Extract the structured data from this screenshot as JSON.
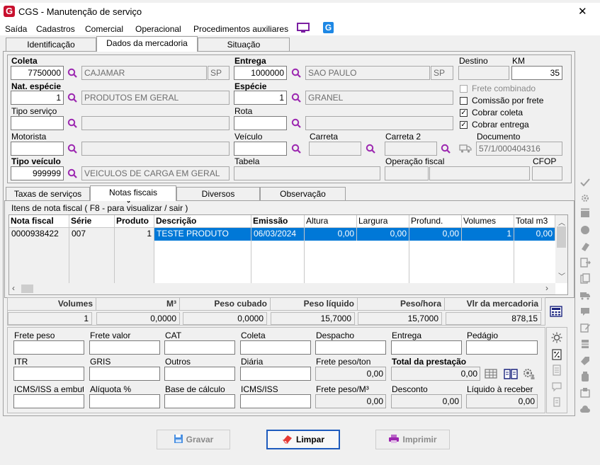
{
  "window": {
    "title": "CGS - Manutenção de serviço",
    "close": "✕"
  },
  "menu": [
    "Saída",
    "Cadastros",
    "Comercial",
    "Operacional",
    "Procedimentos auxiliares"
  ],
  "top_tabs": [
    "Identificação",
    "Dados da mercadoria",
    "Situação"
  ],
  "coleta": {
    "label": "Coleta",
    "code": "7750000",
    "city": "CAJAMAR",
    "uf": "SP"
  },
  "entrega": {
    "label": "Entrega",
    "code": "1000000",
    "city": "SAO PAULO",
    "uf": "SP"
  },
  "destino": {
    "label": "Destino",
    "value": ""
  },
  "km": {
    "label": "KM",
    "value": "35"
  },
  "nat_especie": {
    "label": "Nat. espécie",
    "code": "1",
    "desc": "PRODUTOS EM GERAL"
  },
  "especie": {
    "label": "Espécie",
    "code": "1",
    "desc": "GRANEL"
  },
  "checks": {
    "frete_combinado": {
      "label": "Frete combinado",
      "mark": ""
    },
    "comissao": {
      "label": "Comissão por frete",
      "mark": ""
    },
    "cobrar_coleta": {
      "label": "Cobrar coleta",
      "mark": "✓"
    },
    "cobrar_entrega": {
      "label": "Cobrar entrega",
      "mark": "✓"
    }
  },
  "tipo_servico": {
    "label": "Tipo serviço"
  },
  "rota": {
    "label": "Rota"
  },
  "motorista": {
    "label": "Motorista"
  },
  "veiculo": {
    "label": "Veículo"
  },
  "carreta": {
    "label": "Carreta"
  },
  "carreta2": {
    "label": "Carreta 2"
  },
  "documento": {
    "label": "Documento",
    "value": "57/1/000404316"
  },
  "tipo_veiculo": {
    "label": "Tipo veículo",
    "code": "999999",
    "desc": "VEICULOS DE CARGA EM GERAL"
  },
  "tabela": {
    "label": "Tabela"
  },
  "operacao_fiscal": {
    "label": "Operação fiscal"
  },
  "cfop": {
    "label": "CFOP"
  },
  "sub_tabs": [
    "Taxas de serviços",
    "Notas fiscais",
    "Diversos",
    "Observação"
  ],
  "itens": {
    "legend": "Itens de nota fiscal ( F8 - para visualizar / sair )",
    "columns": [
      "Nota fiscal",
      "Série",
      "Produto",
      "Descrição",
      "Emissão",
      "Altura",
      "Largura",
      "Profund.",
      "Volumes",
      "Total m3"
    ],
    "rows": [
      [
        "0000938422",
        "007",
        "1",
        "TESTE PRODUTO",
        "06/03/2024",
        "0,00",
        "0,00",
        "0,00",
        "1",
        "0,00"
      ]
    ]
  },
  "totals": {
    "headers": [
      "Volumes",
      "M³",
      "Peso cubado",
      "Peso líquido",
      "Peso/hora",
      "Vlr da mercadoria"
    ],
    "values": [
      "1",
      "0,0000",
      "0,0000",
      "15,7000",
      "15,7000",
      "878,15"
    ]
  },
  "frete": {
    "row1": [
      "Frete peso",
      "Frete valor",
      "CAT",
      "Coleta",
      "Despacho",
      "Entrega",
      "Pedágio"
    ],
    "row2_labels": [
      "ITR",
      "GRIS",
      "Outros",
      "Diária",
      "Frete peso/ton",
      "Total da prestação"
    ],
    "frete_peso_ton": "0,00",
    "total_prestacao": "0,00",
    "row3_labels": [
      "ICMS/ISS a embutir",
      "Alíquota %",
      "Base de cálculo",
      "ICMS/ISS",
      "Frete peso/M³",
      "Desconto",
      "Líquido à receber"
    ],
    "frete_peso_m3": "0,00",
    "desconto": "0,00",
    "liquido": "0,00"
  },
  "buttons": {
    "gravar": "Gravar",
    "limpar": "Limpar",
    "imprimir": "Imprimir"
  },
  "colors": {
    "accent": "#1e5bbd",
    "selection": "#0078d7",
    "brand": "#c8102e"
  }
}
